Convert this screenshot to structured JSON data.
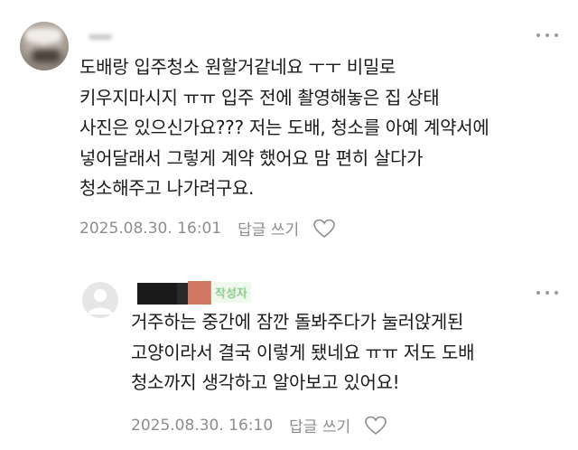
{
  "comment": {
    "text": "도배랑 입주청소 원할거같네요 ㅜㅜ 비밀로\n키우지마시지 ㅠㅠ 입주 전에 촬영해놓은 집 상태\n사진은 있으신가요??? 저는 도배, 청소를 아예 계약서에\n넣어달래서 그렇게 계약 했어요 맘 편히 살다가\n청소해주고 나가려구요.",
    "date": "2025.08.30. 16:01",
    "reply_label": "답글 쓰기"
  },
  "reply": {
    "author_badge": "작성자",
    "text": "거주하는 중간에 잠깐 돌봐주다가 눌러앉게된\n고양이라서 결국 이렇게 됐네요 ㅠㅠ 저도 도배\n청소까지 생각하고 알아보고 있어요!",
    "date": "2025.08.30. 16:10",
    "reply_label": "답글 쓰기"
  },
  "icons": {
    "more": "more-vertical-dots-icon",
    "like": "heart-outline-icon",
    "default_avatar": "default-profile-icon"
  },
  "colors": {
    "meta_text": "#8d8d8d",
    "author_badge_text": "#57b45a",
    "author_badge_bg": "#eef8ec"
  }
}
